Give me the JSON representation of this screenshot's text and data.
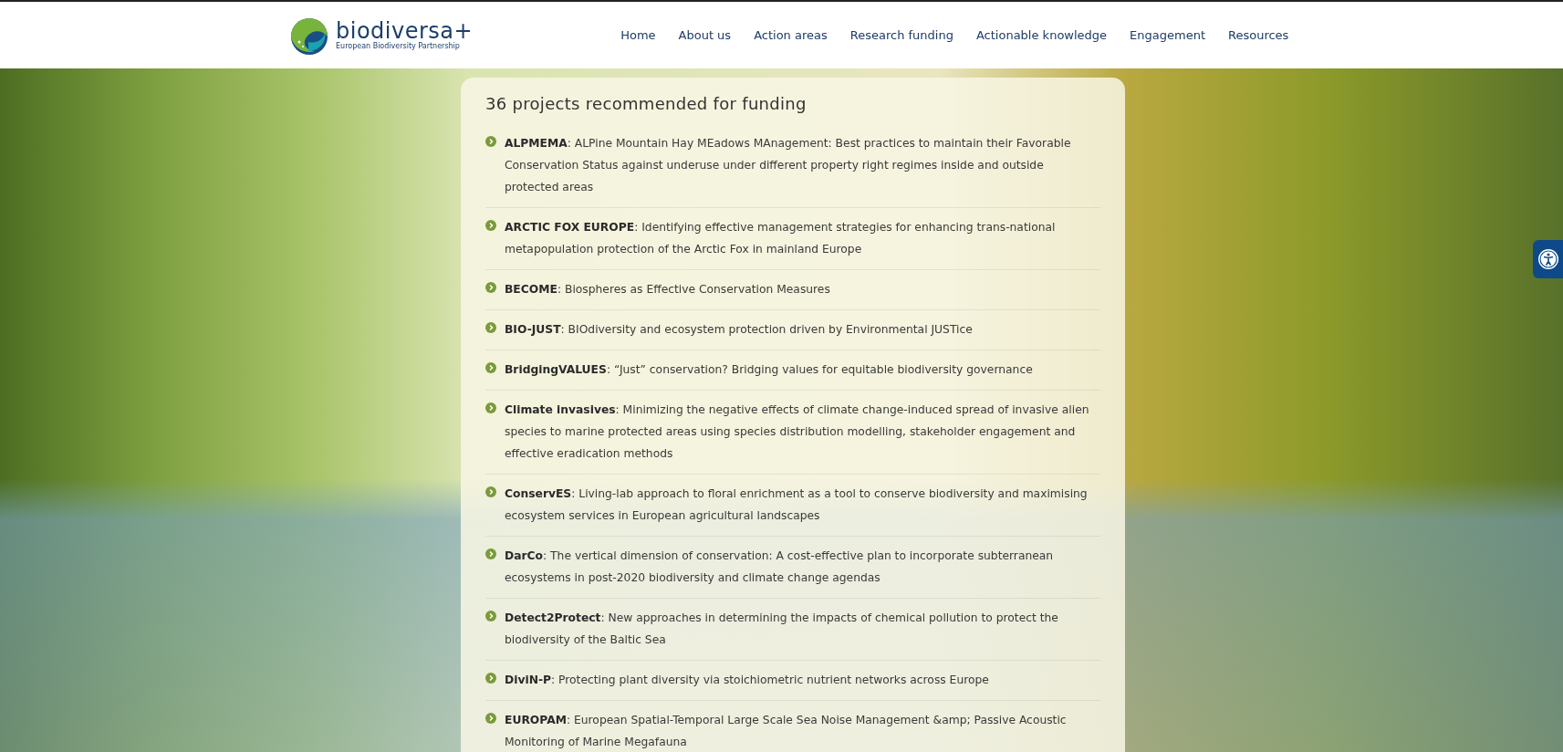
{
  "header": {
    "logo": {
      "name": "biodiversa+",
      "tagline": "European Biodiversity Partnership"
    },
    "nav": [
      "Home",
      "About us",
      "Action areas",
      "Research funding",
      "Actionable knowledge",
      "Engagement",
      "Resources"
    ]
  },
  "panel": {
    "title": "36 projects recommended for funding",
    "projects": [
      "**ALPMEMA**: ALPine Mountain Hay MEadows MAnagement: Best practices to maintain their Favorable Conservation Status against underuse under different property right regimes inside and outside protected areas",
      "**ARCTIC FOX EUROPE**: Identifying effective management strategies for enhancing trans-national metapopulation protection of the Arctic Fox in mainland Europe",
      "**BECOME**: Biospheres as Effective Conservation Measures",
      "**BIO-JUST**: BIOdiversity and ecosystem protection driven by Environmental JUSTice",
      "**BridgingVALUES**: “Just” conservation? Bridging values for equitable biodiversity governance",
      "**Climate invasives**: Minimizing the negative effects of climate change-induced spread of invasive alien species to marine protected areas using species distribution modelling, stakeholder engagement and effective eradication methods",
      "**ConservES**: Living-lab approach to floral enrichment as a tool to conserve biodiversity and maximising ecosystem services in European agricultural landscapes",
      "**DarCo**: The vertical dimension of conservation: A cost-effective plan to incorporate subterranean ecosystems in post-2020 biodiversity and climate change agendas",
      "**Detect2Protect**: New approaches in determining the impacts of chemical pollution to protect the biodiversity of the Baltic Sea",
      "**DiviN-P**: Protecting plant diversity via stoichiometric nutrient networks across Europe",
      "**EUROPAM**: European Spatial-Temporal Large Scale Sea Noise Management &amp; Passive Acoustic Monitoring of Marine Megafauna"
    ]
  }
}
